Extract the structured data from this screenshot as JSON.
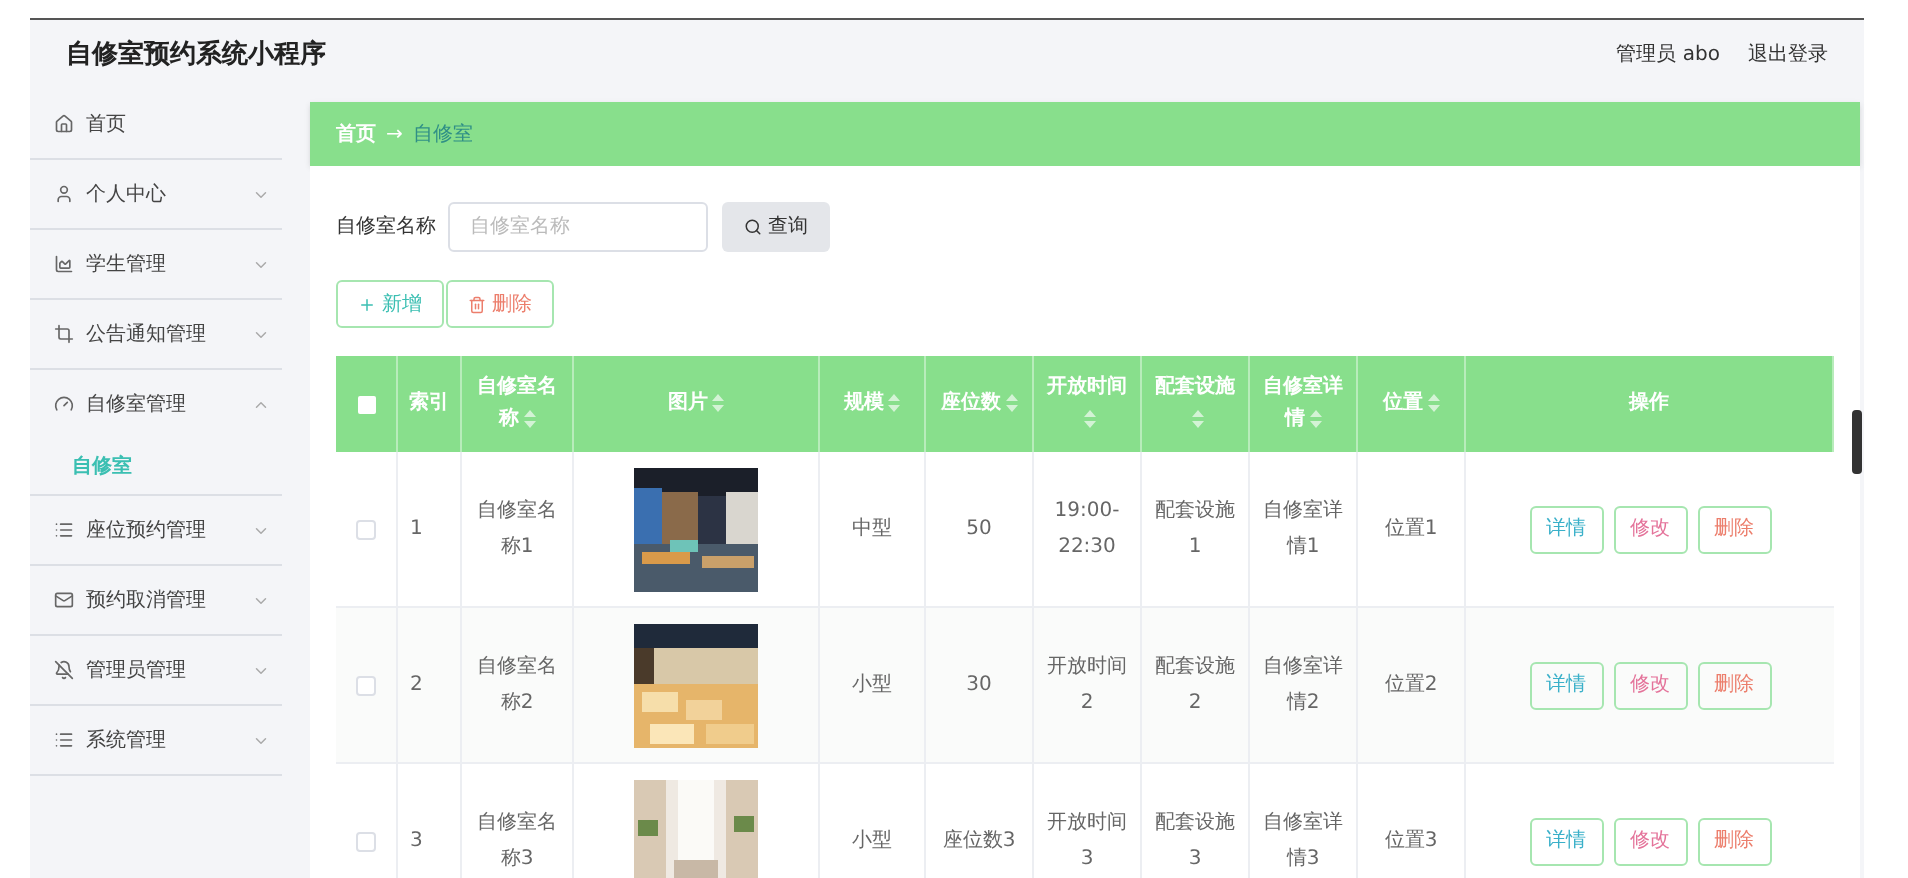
{
  "header": {
    "title": "自修室预约系统小程序",
    "user": "管理员 abo",
    "logout": "退出登录"
  },
  "sidebar": {
    "items": [
      {
        "label": "首页",
        "kind": "link"
      },
      {
        "label": "个人中心",
        "kind": "menu",
        "expanded": false
      },
      {
        "label": "学生管理",
        "kind": "menu",
        "expanded": false
      },
      {
        "label": "公告通知管理",
        "kind": "menu",
        "expanded": false
      },
      {
        "label": "自修室管理",
        "kind": "menu",
        "expanded": true,
        "children": [
          {
            "label": "自修室",
            "selected": true
          }
        ]
      },
      {
        "label": "座位预约管理",
        "kind": "menu",
        "expanded": false
      },
      {
        "label": "预约取消管理",
        "kind": "menu",
        "expanded": false
      },
      {
        "label": "管理员管理",
        "kind": "menu",
        "expanded": false
      },
      {
        "label": "系统管理",
        "kind": "menu",
        "expanded": false
      }
    ]
  },
  "breadcrumb": {
    "home": "首页",
    "separator": "→",
    "current": "自修室"
  },
  "search": {
    "label": "自修室名称",
    "placeholder": "自修室名称",
    "button": "查询"
  },
  "actions": {
    "add": "新增",
    "delete": "删除"
  },
  "table": {
    "columns": [
      {
        "label": "索引",
        "sortable": false
      },
      {
        "label": "自修室名称",
        "sortable": true
      },
      {
        "label": "图片",
        "sortable": true
      },
      {
        "label": "规模",
        "sortable": true
      },
      {
        "label": "座位数",
        "sortable": true
      },
      {
        "label": "开放时间",
        "sortable": true
      },
      {
        "label": "配套设施",
        "sortable": true
      },
      {
        "label": "自修室详情",
        "sortable": true
      },
      {
        "label": "位置",
        "sortable": true
      },
      {
        "label": "操作",
        "sortable": false
      }
    ],
    "header_checked": false,
    "rows": [
      {
        "checked": false,
        "index": "1",
        "name": "自修室名称1",
        "scale": "中型",
        "seats": "50",
        "hours": "19:00-22:30",
        "facilities": "配套设施1",
        "detail": "自修室详情1",
        "location": "位置1",
        "buttons": [
          "详情",
          "修改",
          "删除"
        ]
      },
      {
        "checked": false,
        "index": "2",
        "name": "自修室名称2",
        "scale": "小型",
        "seats": "30",
        "hours": "开放时间2",
        "facilities": "配套设施2",
        "detail": "自修室详情2",
        "location": "位置2",
        "buttons": [
          "详情",
          "修改",
          "删除"
        ]
      },
      {
        "checked": false,
        "index": "3",
        "name": "自修室名称3",
        "scale": "小型",
        "seats": "座位数3",
        "hours": "开放时间3",
        "facilities": "配套设施3",
        "detail": "自修室详情3",
        "location": "位置3",
        "buttons": [
          "详情",
          "修改",
          "删除"
        ]
      }
    ]
  }
}
